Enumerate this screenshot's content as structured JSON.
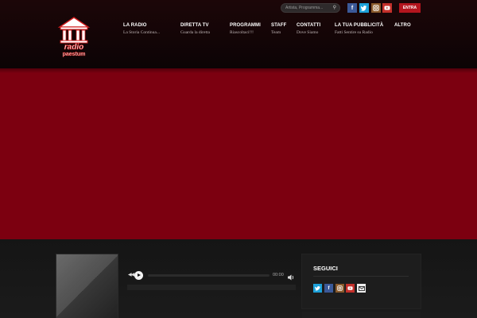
{
  "header": {
    "search": {
      "placeholder": "Artista, Programma..."
    },
    "login_label": "ENTRA",
    "social": [
      "facebook-icon",
      "twitter-icon",
      "instagram-icon",
      "youtube-icon"
    ],
    "logo": {
      "line1": "radio",
      "line2": "paestum"
    }
  },
  "nav": [
    {
      "title": "LA RADIO",
      "subtitle": "La Storia Continua..."
    },
    {
      "title": "DIRETTA TV",
      "subtitle": "Guarda la diretta"
    },
    {
      "title": "PROGRAMMI",
      "subtitle": "Riascoltaci!!!"
    },
    {
      "title": "STAFF",
      "subtitle": "Team"
    },
    {
      "title": "CONTATTI",
      "subtitle": "Dove Siamo"
    },
    {
      "title": "LA TUA PUBBLICITÀ",
      "subtitle": "Fatti Sentire su Radio"
    },
    {
      "title": "ALTRO",
      "subtitle": ""
    }
  ],
  "player": {
    "time": "00:00",
    "progress": 0
  },
  "sidebar": {
    "follow_title": "SEGUICI",
    "social": [
      "twitter-icon",
      "facebook-icon",
      "instagram-icon",
      "youtube-icon",
      "email-icon"
    ]
  },
  "colors": {
    "accent": "#b3151e",
    "hero": "#7c0010",
    "facebook": "#3b5998",
    "twitter": "#1da1d9",
    "instagram": "#8a5a2b",
    "youtube": "#c4302b"
  }
}
